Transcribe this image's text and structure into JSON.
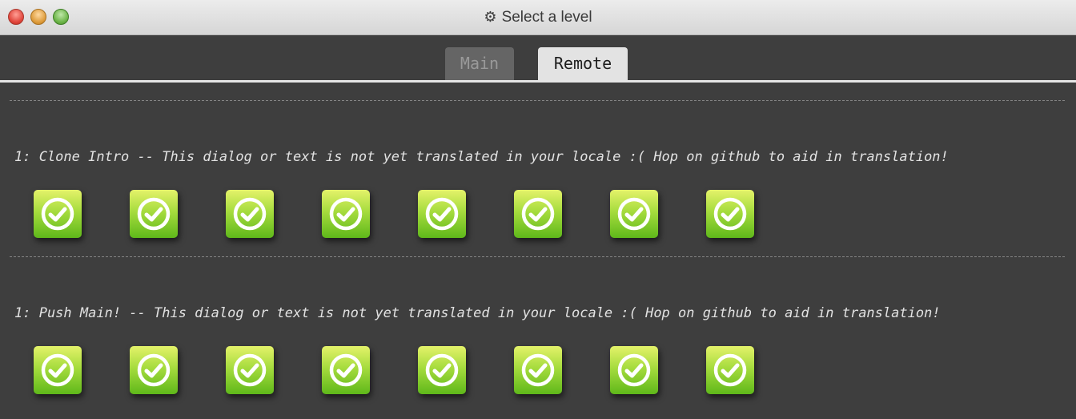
{
  "window": {
    "title": "Select a level",
    "title_icon": "gear-icon"
  },
  "tabs": [
    {
      "label": "Main",
      "selected": false
    },
    {
      "label": "Remote",
      "selected": true
    }
  ],
  "sections": [
    {
      "title": "1: Clone Intro -- This dialog or text is not yet translated in your locale :( Hop on github to aid in translation!",
      "levels_completed": 8,
      "level_icon": "check-circle-icon"
    },
    {
      "title": "1: Push Main! -- This dialog or text is not yet translated in your locale :( Hop on github to aid in translation!",
      "levels_completed": 8,
      "level_icon": "check-circle-icon"
    }
  ],
  "colors": {
    "background": "#3e3e3e",
    "level_green": "#7ec82a",
    "tab_selected": "#e3e3e3",
    "tab_unselected": "#656565"
  }
}
